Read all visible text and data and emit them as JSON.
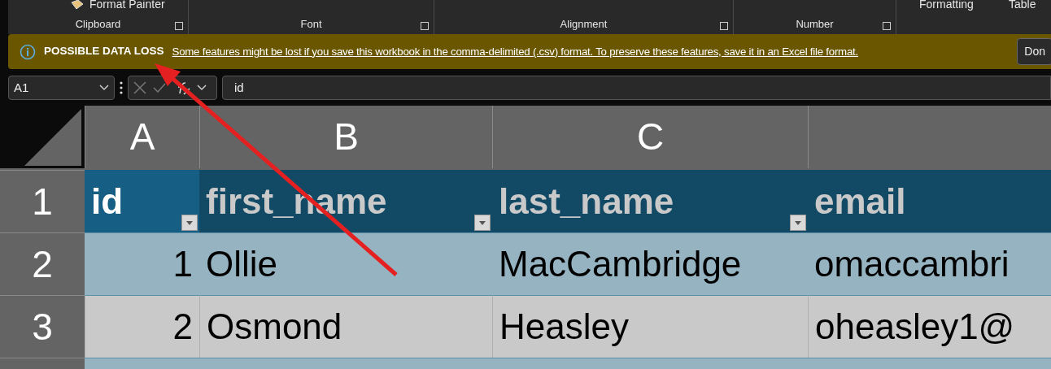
{
  "ribbon": {
    "top_items": [
      {
        "label": "Format Painter",
        "kind": "painter"
      },
      {
        "label": "Formatting",
        "kind": "plain"
      },
      {
        "label": "Table",
        "kind": "plain"
      }
    ],
    "groups": [
      {
        "label": "Clipboard",
        "launcher": true
      },
      {
        "label": "Font",
        "launcher": true
      },
      {
        "label": "Alignment",
        "launcher": true
      },
      {
        "label": "Number",
        "launcher": true
      }
    ]
  },
  "message_bar": {
    "title": "POSSIBLE DATA LOSS",
    "text": "Some features might be lost if you save this workbook in the comma-delimited (.csv) format. To preserve these features, save it in an Excel file format.",
    "button": "Don"
  },
  "formula_bar": {
    "name_box": "A1",
    "formula": "id"
  },
  "grid": {
    "columns": [
      "A",
      "B",
      "C",
      ""
    ],
    "rows": [
      {
        "header": "1",
        "kind": "table-header",
        "cells": [
          {
            "text": "id",
            "selected": true,
            "filter": true
          },
          {
            "text": "first_name",
            "selected": false,
            "filter": true
          },
          {
            "text": "last_name",
            "selected": false,
            "filter": true
          },
          {
            "text": "email",
            "selected": false,
            "filter": false
          }
        ]
      },
      {
        "header": "2",
        "kind": "band",
        "cells": [
          {
            "text": "1",
            "selected": false,
            "filter": false
          },
          {
            "text": "Ollie",
            "selected": false,
            "filter": false
          },
          {
            "text": "MacCambridge",
            "selected": false,
            "filter": false
          },
          {
            "text": "omaccambri",
            "selected": false,
            "filter": false
          }
        ]
      },
      {
        "header": "3",
        "kind": "plain",
        "cells": [
          {
            "text": "2",
            "selected": false,
            "filter": false
          },
          {
            "text": "Osmond",
            "selected": false,
            "filter": false
          },
          {
            "text": "Heasley",
            "selected": false,
            "filter": false
          },
          {
            "text": "oheasley1@",
            "selected": false,
            "filter": false
          }
        ]
      },
      {
        "header": "",
        "kind": "band",
        "cells": []
      }
    ]
  }
}
